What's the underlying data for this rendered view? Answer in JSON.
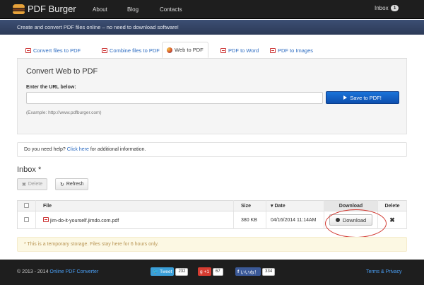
{
  "header": {
    "logo_text": "PDF Burger",
    "nav": [
      "About",
      "Blog",
      "Contacts"
    ],
    "inbox_label": "Inbox",
    "inbox_count": "1"
  },
  "subheader": "Create and convert PDF files online – no need to download software!",
  "tabs": [
    {
      "label": "Convert files to PDF",
      "icon": "pdf-icon"
    },
    {
      "label": "Combine files to PDF",
      "icon": "pdf-icon"
    },
    {
      "label": "Web to PDF",
      "icon": "globe-icon",
      "active": true
    },
    {
      "label": "PDF to Word",
      "icon": "pdf-icon"
    },
    {
      "label": "PDF to Images",
      "icon": "pdf-icon"
    }
  ],
  "convert": {
    "title": "Convert Web to PDF",
    "url_label": "Enter the URL below:",
    "url_value": "",
    "save_button": "Save to PDF!",
    "example": "(Example: http://www.pdfburger.com)"
  },
  "help": {
    "prefix": "Do you need help?",
    "link": "Click here",
    "suffix": "for additional information."
  },
  "inbox": {
    "title": "Inbox *",
    "delete_button": "Delete",
    "refresh_button": "Refresh",
    "columns": [
      "File",
      "Size",
      "Date",
      "Download",
      "Delete"
    ],
    "rows": [
      {
        "file": "jim-do-it-yourself.jimdo.com.pdf",
        "size": "380 KB",
        "date": "04/16/2014 11:14AM",
        "download": "Download"
      }
    ],
    "note": "* This is a temporary storage. Files stay here for 6 hours only."
  },
  "footer": {
    "copyright": "© 2013 - 2014",
    "copyright_link": "Online PDF Converter",
    "tweet_label": "Tweet",
    "tweet_count": "232",
    "gplus_label": "+1",
    "gplus_count": "67",
    "fb_label": "いいね！",
    "fb_count": "334",
    "terms": "Terms & Privacy"
  },
  "colors": {
    "topbar": "#1e1e1e",
    "subbar": "#34456a",
    "accent_blue": "#1a73d9",
    "highlight_red": "#d23b33"
  }
}
